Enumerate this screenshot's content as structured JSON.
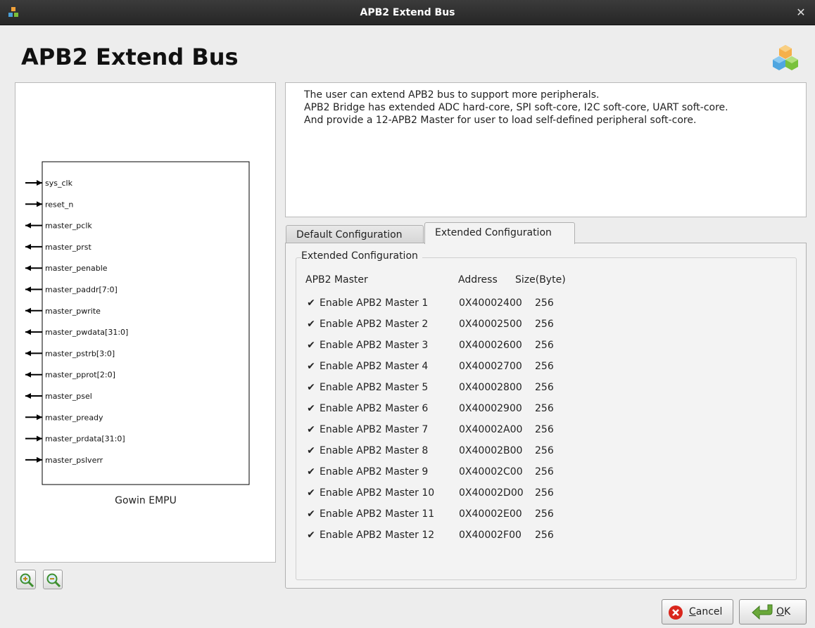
{
  "window": {
    "title": "APB2 Extend Bus"
  },
  "header": {
    "title": "APB2 Extend Bus"
  },
  "diagram": {
    "block_label": "Gowin EMPU",
    "ports": [
      {
        "name": "sys_clk",
        "dir": "in"
      },
      {
        "name": "reset_n",
        "dir": "in"
      },
      {
        "name": "master_pclk",
        "dir": "out"
      },
      {
        "name": "master_prst",
        "dir": "out"
      },
      {
        "name": "master_penable",
        "dir": "out"
      },
      {
        "name": "master_paddr[7:0]",
        "dir": "out"
      },
      {
        "name": "master_pwrite",
        "dir": "out"
      },
      {
        "name": "master_pwdata[31:0]",
        "dir": "out"
      },
      {
        "name": "master_pstrb[3:0]",
        "dir": "out"
      },
      {
        "name": "master_pprot[2:0]",
        "dir": "out"
      },
      {
        "name": "master_psel",
        "dir": "out"
      },
      {
        "name": "master_pready",
        "dir": "in"
      },
      {
        "name": "master_prdata[31:0]",
        "dir": "in"
      },
      {
        "name": "master_pslverr",
        "dir": "in"
      }
    ]
  },
  "description": {
    "lines": [
      "The user can extend APB2 bus to support more peripherals.",
      "APB2 Bridge has extended ADC hard-core, SPI soft-core, I2C soft-core, UART soft-core.",
      "And provide a 12-APB2 Master for user to load self-defined peripheral soft-core."
    ]
  },
  "tabs": [
    {
      "label": "Default Configuration",
      "active": false
    },
    {
      "label": "Extended Configuration",
      "active": true
    }
  ],
  "extended": {
    "group_title": "Extended Configuration",
    "columns": [
      "APB2 Master",
      "Address",
      "Size(Byte)"
    ],
    "masters": [
      {
        "label": "Enable APB2 Master 1",
        "checked": true,
        "address": "0X40002400",
        "size": "256"
      },
      {
        "label": "Enable APB2 Master 2",
        "checked": true,
        "address": "0X40002500",
        "size": "256"
      },
      {
        "label": "Enable APB2 Master 3",
        "checked": true,
        "address": "0X40002600",
        "size": "256"
      },
      {
        "label": "Enable APB2 Master 4",
        "checked": true,
        "address": "0X40002700",
        "size": "256"
      },
      {
        "label": "Enable APB2 Master 5",
        "checked": true,
        "address": "0X40002800",
        "size": "256"
      },
      {
        "label": "Enable APB2 Master 6",
        "checked": true,
        "address": "0X40002900",
        "size": "256"
      },
      {
        "label": "Enable APB2 Master 7",
        "checked": true,
        "address": "0X40002A00",
        "size": "256"
      },
      {
        "label": "Enable APB2 Master 8",
        "checked": true,
        "address": "0X40002B00",
        "size": "256"
      },
      {
        "label": "Enable APB2 Master 9",
        "checked": true,
        "address": "0X40002C00",
        "size": "256"
      },
      {
        "label": "Enable APB2 Master 10",
        "checked": true,
        "address": "0X40002D00",
        "size": "256"
      },
      {
        "label": "Enable APB2 Master 11",
        "checked": true,
        "address": "0X40002E00",
        "size": "256"
      },
      {
        "label": "Enable APB2 Master 12",
        "checked": true,
        "address": "0X40002F00",
        "size": "256"
      }
    ]
  },
  "buttons": {
    "cancel": {
      "mnemonic": "C",
      "rest": "ancel"
    },
    "ok": {
      "mnemonic": "O",
      "rest": "K"
    }
  },
  "icons": {
    "app": "cubes-icon",
    "close": "close-icon",
    "logo": "cubes-logo-icon",
    "zoom_in": "zoom-in-icon",
    "zoom_out": "zoom-out-icon",
    "cancel": "cancel-icon",
    "ok": "ok-arrow-icon"
  },
  "colors": {
    "titlebar": "#2e2e2e",
    "cancel_red": "#d9261c",
    "ok_green": "#6aa83a"
  }
}
